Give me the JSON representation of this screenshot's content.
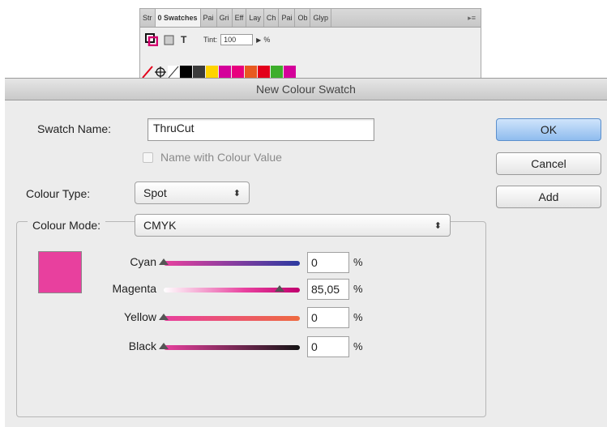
{
  "swatches_panel": {
    "tabs": [
      "Str",
      "0 Swatches",
      "Pai",
      "Gri",
      "Eff",
      "Lay",
      "Ch",
      "Pai",
      "Ob",
      "Glyp"
    ],
    "active_tab": 1,
    "tint_label": "Tint:",
    "tint_value": "100",
    "tint_unit": "%",
    "swatch_colors": [
      "#000000",
      "#3b3b3b",
      "#ffd400",
      "#d4009a",
      "#e8007e",
      "#e85a20",
      "#e3001b",
      "#3dae2b",
      "#d4009a"
    ]
  },
  "dialog": {
    "title": "New Colour Swatch",
    "swatch_name_label": "Swatch Name:",
    "swatch_name_value": "ThruCut",
    "name_with_value_label": "Name with Colour Value",
    "colour_type_label": "Colour Type:",
    "colour_type_value": "Spot",
    "colour_mode_label": "Colour Mode:",
    "colour_mode_value": "CMYK",
    "preview_color": "#e8409e",
    "sliders": [
      {
        "label": "Cyan",
        "value": "0",
        "unit": "%",
        "level": 0
      },
      {
        "label": "Magenta",
        "value": "85,05",
        "unit": "%",
        "level": 0.8505
      },
      {
        "label": "Yellow",
        "value": "0",
        "unit": "%",
        "level": 0
      },
      {
        "label": "Black",
        "value": "0",
        "unit": "%",
        "level": 0
      }
    ],
    "buttons": {
      "ok": "OK",
      "cancel": "Cancel",
      "add": "Add"
    },
    "accent_color": "#8fbcee"
  }
}
